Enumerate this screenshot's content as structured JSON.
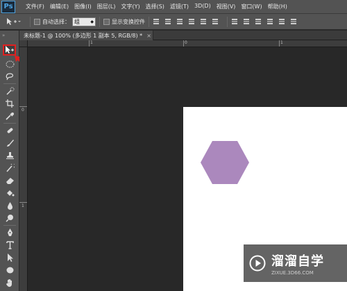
{
  "app": {
    "logo": "Ps"
  },
  "menu": [
    "文件(F)",
    "编辑(E)",
    "图像(I)",
    "图层(L)",
    "文字(Y)",
    "选择(S)",
    "滤镜(T)",
    "3D(D)",
    "视图(V)",
    "窗口(W)",
    "帮助(H)"
  ],
  "options": {
    "auto_select_label": "自动选择：",
    "auto_select_value": "组",
    "show_transform_label": "显示变换控件"
  },
  "document": {
    "tab_title": "未标题-1 @ 100% (多边形 1 副本 5, RGB/8) *",
    "close_glyph": "×"
  },
  "rulers": {
    "h_labels": [
      "1",
      "0",
      "1"
    ],
    "v_labels": [
      "0",
      "1"
    ]
  },
  "shape": {
    "type": "hexagon",
    "fill": "#ab88bd"
  },
  "colors": {
    "accent_highlight": "#e02020",
    "canvas_bg": "#ffffff",
    "workspace_bg": "#282828"
  },
  "watermark": {
    "title": "溜溜自学",
    "url": "ZIXUE.3D66.COM"
  },
  "tools": [
    "move-tool",
    "marquee-tool",
    "lasso-tool",
    "quick-select-tool",
    "crop-tool",
    "eyedropper-tool",
    "healing-brush-tool",
    "brush-tool",
    "clone-stamp-tool",
    "history-brush-tool",
    "eraser-tool",
    "paint-bucket-tool",
    "blur-tool",
    "dodge-tool",
    "pen-tool",
    "type-tool",
    "path-select-tool",
    "shape-tool",
    "hand-tool"
  ]
}
